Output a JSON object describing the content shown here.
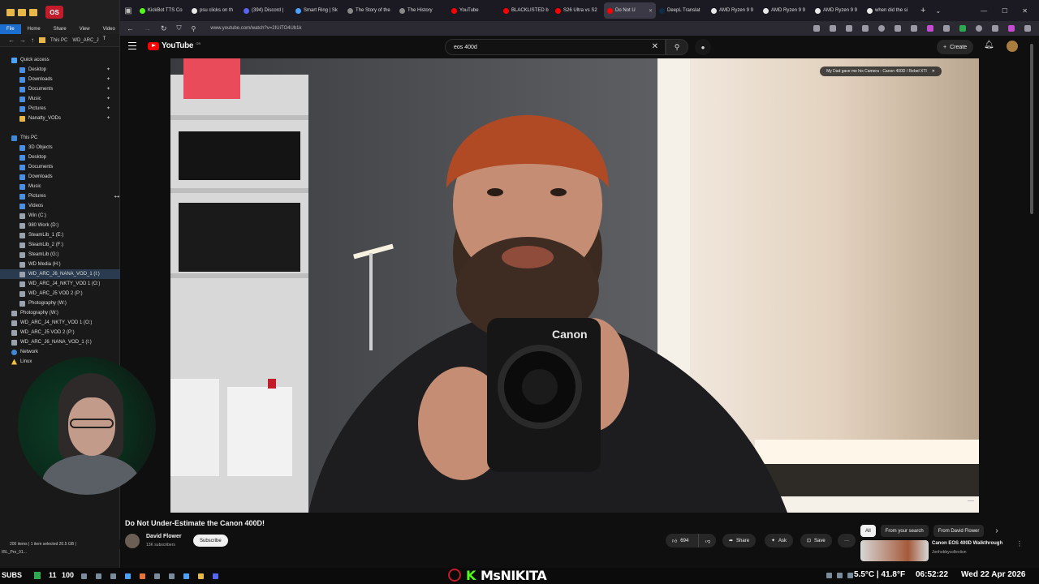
{
  "explorer": {
    "badge": "OS",
    "ribbon": [
      "File",
      "Home",
      "Share",
      "View",
      "Video T"
    ],
    "breadcrumb": [
      "This PC",
      "WD_ARC_J"
    ],
    "tree": [
      {
        "label": "Quick access",
        "icon": "star",
        "indent": 1
      },
      {
        "label": "Desktop",
        "icon": "blue",
        "indent": 2,
        "pinned": true
      },
      {
        "label": "Downloads",
        "icon": "blue",
        "indent": 2,
        "pinned": true
      },
      {
        "label": "Documents",
        "icon": "blue",
        "indent": 2,
        "pinned": true
      },
      {
        "label": "Music",
        "icon": "blue",
        "indent": 2,
        "pinned": true
      },
      {
        "label": "Pictures",
        "icon": "blue",
        "indent": 2,
        "pinned": true
      },
      {
        "label": "Nanatty_VODs",
        "icon": "yellow",
        "indent": 2,
        "pinned": true
      },
      {
        "label": "",
        "icon": "",
        "indent": 0
      },
      {
        "label": "This PC",
        "icon": "pc",
        "indent": 1
      },
      {
        "label": "3D Objects",
        "icon": "blue",
        "indent": 2
      },
      {
        "label": "Desktop",
        "icon": "blue",
        "indent": 2
      },
      {
        "label": "Documents",
        "icon": "blue",
        "indent": 2
      },
      {
        "label": "Downloads",
        "icon": "blue",
        "indent": 2
      },
      {
        "label": "Music",
        "icon": "blue",
        "indent": 2
      },
      {
        "label": "Pictures",
        "icon": "blue",
        "indent": 2
      },
      {
        "label": "Videos",
        "icon": "blue",
        "indent": 2
      },
      {
        "label": "Win (C:)",
        "icon": "drive",
        "indent": 2
      },
      {
        "label": "980 Work (D:)",
        "icon": "drive",
        "indent": 2
      },
      {
        "label": "SteamLib_1 (E:)",
        "icon": "drive",
        "indent": 2
      },
      {
        "label": "SteamLib_2 (F:)",
        "icon": "drive",
        "indent": 2
      },
      {
        "label": "SteamLib (G:)",
        "icon": "drive",
        "indent": 2
      },
      {
        "label": "WD Media (H:)",
        "icon": "drive",
        "indent": 2
      },
      {
        "label": "WD_ARC_J6_NANA_VOD_1 (I:)",
        "icon": "drive",
        "indent": 2,
        "selected": true
      },
      {
        "label": "WD_ARC_J4_NKTY_VOD 1 (O:)",
        "icon": "drive",
        "indent": 2
      },
      {
        "label": "WD_ARC_J5 VOD 2 (P:)",
        "icon": "drive",
        "indent": 2
      },
      {
        "label": "Photography (W:)",
        "icon": "drive",
        "indent": 2
      },
      {
        "label": "Photography (W:)",
        "icon": "drive",
        "indent": 1
      },
      {
        "label": "WD_ARC_J4_NKTY_VOD 1 (O:)",
        "icon": "drive",
        "indent": 1
      },
      {
        "label": "WD_ARC_J5 VOD 2 (P:)",
        "icon": "drive",
        "indent": 1
      },
      {
        "label": "WD_ARC_J6_NANA_VOD_1 (I:)",
        "icon": "drive",
        "indent": 1
      },
      {
        "label": "Network",
        "icon": "net",
        "indent": 1
      },
      {
        "label": "Linux",
        "icon": "linux",
        "indent": 1
      }
    ],
    "status": "200 items  |  1 item selected  20.5 GB  |",
    "footer": "IRL_Pro_01..."
  },
  "browser": {
    "tabs": [
      {
        "label": "KickBot TTS Co",
        "color": "#53fc18"
      },
      {
        "label": "psu clicks on th",
        "color": "#e8e8e8"
      },
      {
        "label": "(394) Discord | ",
        "color": "#5865f2"
      },
      {
        "label": "Smart Ring | Sk",
        "color": "#4aa3ff"
      },
      {
        "label": "The Story of the",
        "color": "#888888"
      },
      {
        "label": "The History",
        "color": "#888888"
      },
      {
        "label": "YouTube",
        "color": "#ff0000"
      },
      {
        "label": "BLACKLISTED b",
        "color": "#ff0000"
      },
      {
        "label": "S26 Ultra vs S2",
        "color": "#ff0000"
      },
      {
        "label": "Do Not U",
        "color": "#ff0000",
        "active": true
      },
      {
        "label": "DeepL Translat",
        "color": "#0f2b46"
      },
      {
        "label": "AMD Ryzen 9 9",
        "color": "#e8e8e8"
      },
      {
        "label": "AMD Ryzen 9 9",
        "color": "#e8e8e8"
      },
      {
        "label": "AMD Ryzen 9 9",
        "color": "#e8e8e8"
      },
      {
        "label": "when did the si",
        "color": "#e8e8e8"
      }
    ],
    "url": "www.youtube.com/watch?v=2IUiTO4Ub1k"
  },
  "youtube": {
    "logo": "YouTube",
    "logo_country": "GB",
    "search_value": "eos 400d",
    "create_label": "Create",
    "video_overlay_title": "My Dad gave me his Camera - Canon 400D / Rebel XTI",
    "video_title": "Do Not Under-Estimate the Canon 400D!",
    "channel_name": "David Flower",
    "channel_subs": "13K subscribers",
    "subscribe_label": "Subscribe",
    "likes": "694",
    "share_label": "Share",
    "ask_label": "Ask",
    "save_label": "Save",
    "chips": [
      "All",
      "From your search",
      "From David Flower"
    ],
    "rec_title": "Canon EOS 400D Walkthrough",
    "rec_channel": "Jonhobbycollection",
    "camera_brand": "Canon"
  },
  "taskbar": {
    "subs_label": "SUBS",
    "subs_count": "11",
    "follow_count": "100",
    "streamer_k": "K",
    "streamer_name": "MsNIKITA",
    "weather": "5.5°C | 41.8°F",
    "time": "06:52:22",
    "date": "Wed 22 Apr 2026"
  }
}
